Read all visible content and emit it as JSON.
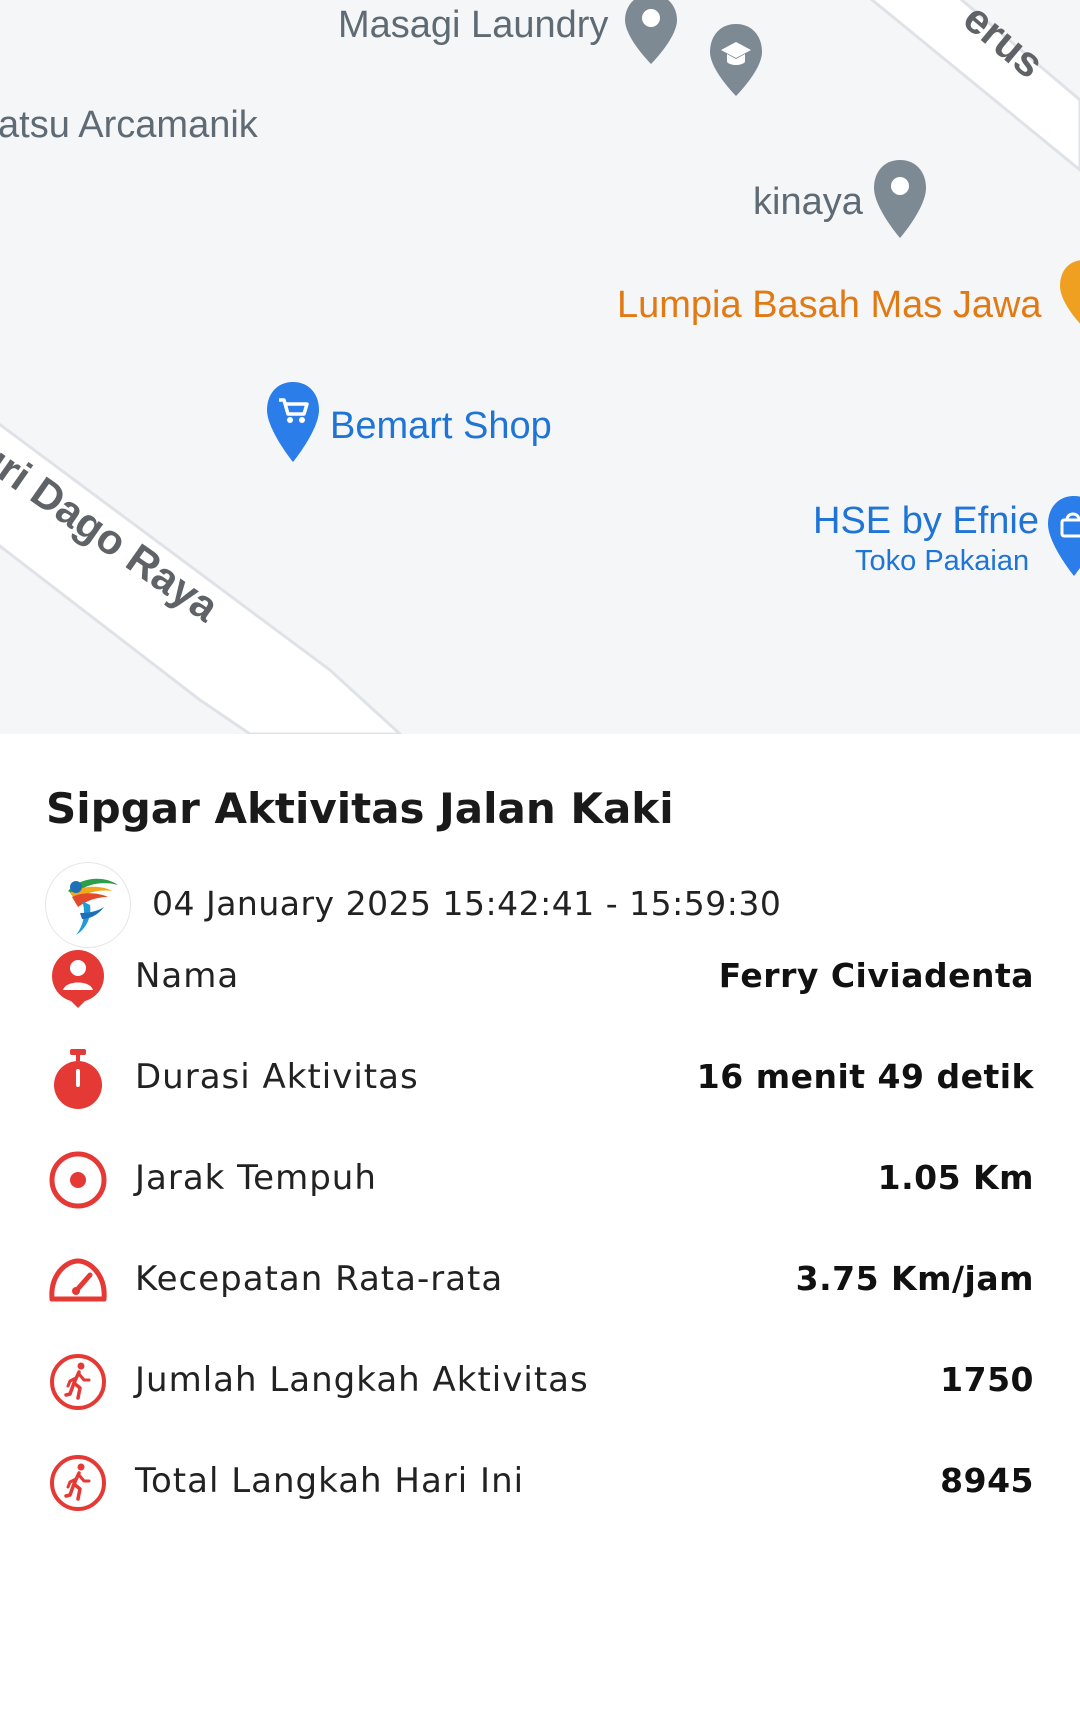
{
  "map": {
    "pois": [
      {
        "name": "Masagi Laundry",
        "icon": "map-pin-icon"
      },
      {
        "name": "atsu Arcamanik",
        "icon": ""
      },
      {
        "name": "kinaya",
        "icon": "map-pin-icon"
      },
      {
        "name": "Lumpia Basah Mas Jawa",
        "icon": "restaurant-pin-icon"
      },
      {
        "name": "Bemart Shop",
        "icon": "shopping-cart-pin-icon"
      },
      {
        "name": "HSE by Efnie",
        "subtitle": "Toko Pakaian",
        "icon": "shopping-bag-pin-icon"
      }
    ],
    "roads": [
      {
        "name": "uri Dago Raya"
      },
      {
        "name": "erus"
      }
    ],
    "colors": {
      "gray_pin": "#7d8a94",
      "orange": "#e27a14",
      "blue": "#1f74d6",
      "road": "#ffffff"
    }
  },
  "summary": {
    "title": "Sipgar Aktivitas Jalan Kaki",
    "datetime": "04 January 2025 15:42:41 - 15:59:30",
    "accent_color": "#e53935",
    "rows": [
      {
        "label": "Nama",
        "value": "Ferry Civiadenta",
        "icon": "person-icon"
      },
      {
        "label": "Durasi Aktivitas",
        "value": "16 menit 49 detik",
        "icon": "stopwatch-icon"
      },
      {
        "label": "Jarak Tempuh",
        "value": "1.05 Km",
        "icon": "target-icon"
      },
      {
        "label": "Kecepatan Rata-rata",
        "value": "3.75 Km/jam",
        "icon": "speedometer-icon"
      },
      {
        "label": "Jumlah Langkah Aktivitas",
        "value": "1750",
        "icon": "walking-icon"
      },
      {
        "label": "Total Langkah Hari Ini",
        "value": "8945",
        "icon": "walking-icon"
      }
    ]
  }
}
